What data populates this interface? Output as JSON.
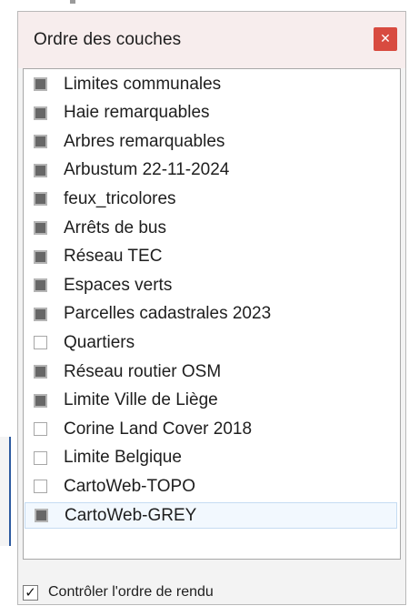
{
  "dialog": {
    "title": "Ordre des couches",
    "close_icon": "close-icon"
  },
  "layers": [
    {
      "label": "Limites communales",
      "checked": true
    },
    {
      "label": "Haie remarquables",
      "checked": true
    },
    {
      "label": "Arbres remarquables",
      "checked": true
    },
    {
      "label": "Arbustum 22-11-2024",
      "checked": true
    },
    {
      "label": "feux_tricolores",
      "checked": true
    },
    {
      "label": "Arrêts de bus",
      "checked": true
    },
    {
      "label": "Réseau TEC",
      "checked": true
    },
    {
      "label": "Espaces verts",
      "checked": true
    },
    {
      "label": "Parcelles cadastrales 2023",
      "checked": true
    },
    {
      "label": "Quartiers",
      "checked": false
    },
    {
      "label": "Réseau routier OSM",
      "checked": true
    },
    {
      "label": "Limite Ville de Liège",
      "checked": true
    },
    {
      "label": "Corine Land Cover 2018",
      "checked": false
    },
    {
      "label": "Limite Belgique",
      "checked": false
    },
    {
      "label": "CartoWeb-TOPO",
      "checked": false
    },
    {
      "label": "CartoWeb-GREY",
      "checked": true,
      "selected": true
    }
  ],
  "footer": {
    "render_order_label": "Contrôler l'ordre de rendu",
    "render_order_checked": true,
    "check_mark": "✓"
  },
  "colors": {
    "titlebar_bg": "#f7eded",
    "close_button": "#d84b40",
    "checked_fill": "#676767",
    "selected_row": "#f2f8fe"
  }
}
